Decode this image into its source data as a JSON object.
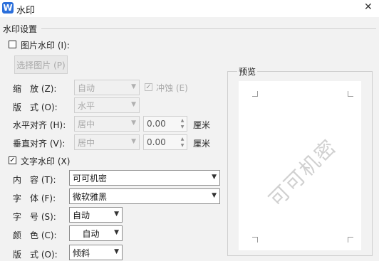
{
  "window": {
    "title": "水印",
    "app_icon_letter": "W",
    "close_glyph": "✕"
  },
  "section": {
    "title": "水印设置"
  },
  "picture_watermark": {
    "checkbox_label": "图片水印 (I):",
    "checked": false,
    "select_button_label": "选择图片 (P)",
    "scale_label": "缩　放 (Z):",
    "scale_value": "自动",
    "washout_label": "冲蚀 (E)",
    "washout_checked": true,
    "layout_label": "版　式 (O):",
    "layout_value": "水平",
    "h_align_label": "水平对齐 (H):",
    "h_align_value": "居中",
    "h_offset_value": "0.00",
    "h_unit": "厘米",
    "v_align_label": "垂直对齐 (V):",
    "v_align_value": "居中",
    "v_offset_value": "0.00",
    "v_unit": "厘米"
  },
  "text_watermark": {
    "checkbox_label": "文字水印 (X)",
    "checked": true,
    "content_label": "内　容 (T):",
    "content_value": "可可机密",
    "font_label": "字　体 (F):",
    "font_value": "微软雅黑",
    "size_label": "字　号 (S):",
    "size_value": "自动",
    "color_label": "颜　色 (C):",
    "color_value": "自动",
    "layout_label": "版　式 (O):",
    "layout_value": "倾斜"
  },
  "preview": {
    "label": "预览",
    "watermark_text": "可可机密"
  },
  "icons": {
    "check": "✓",
    "arrow_down": "▼",
    "spin_up": "▲",
    "spin_down": "▼"
  },
  "colors": {
    "app_icon": "#2b6fdb",
    "watermark": "#d0d0d0",
    "disabled_text": "#a9a9a9"
  }
}
